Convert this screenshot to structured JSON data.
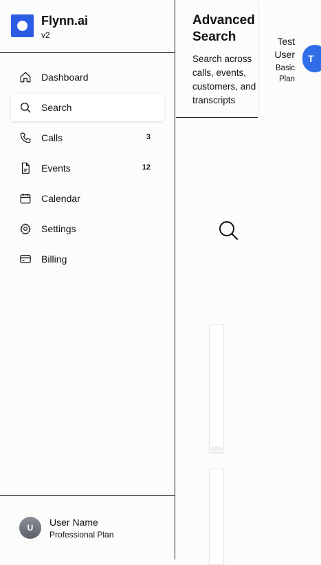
{
  "brand": {
    "name": "Flynn.ai",
    "version": "v2"
  },
  "nav": {
    "items": [
      {
        "label": "Dashboard",
        "icon": "home-icon",
        "badge": "",
        "active": false
      },
      {
        "label": "Search",
        "icon": "search-icon",
        "badge": "",
        "active": true
      },
      {
        "label": "Calls",
        "icon": "phone-icon",
        "badge": "3",
        "active": false
      },
      {
        "label": "Events",
        "icon": "document-icon",
        "badge": "12",
        "active": false
      },
      {
        "label": "Calendar",
        "icon": "calendar-icon",
        "badge": "",
        "active": false
      },
      {
        "label": "Settings",
        "icon": "gear-icon",
        "badge": "",
        "active": false
      },
      {
        "label": "Billing",
        "icon": "credit-card-icon",
        "badge": "",
        "active": false
      }
    ]
  },
  "account": {
    "initial": "U",
    "name": "User Name",
    "plan": "Professional Plan"
  },
  "header": {
    "title": "Advanced Search",
    "subtitle": "Search across calls, events, customers, and transcripts"
  },
  "user": {
    "name": "Test User",
    "plan": "Basic Plan",
    "initial": "T"
  },
  "colors": {
    "brand": "#2c5be4",
    "avatar": "#2f6ee8",
    "border": "#222222"
  }
}
